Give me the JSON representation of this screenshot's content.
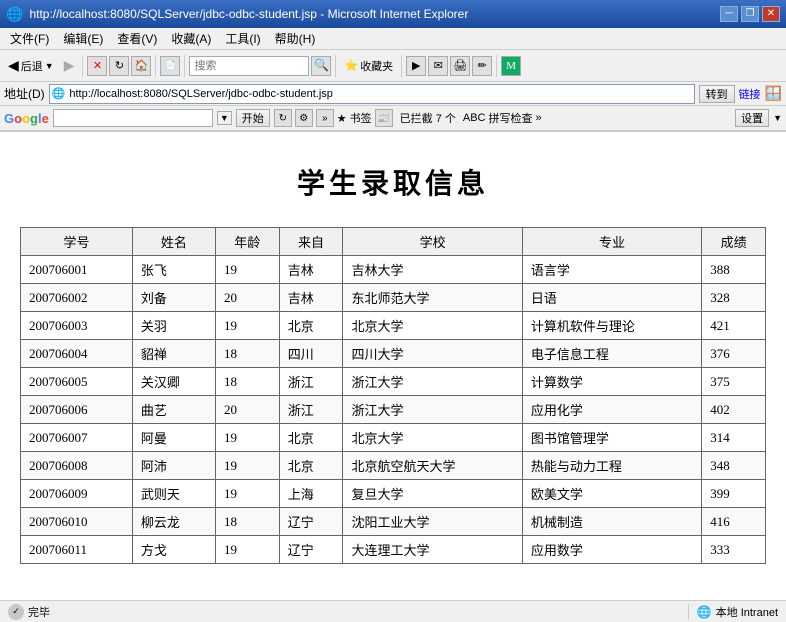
{
  "window": {
    "title": "http://localhost:8080/SQLServer/jdbc-odbc-student.jsp - Microsoft Internet Explorer",
    "icon": "🌐"
  },
  "menubar": {
    "items": [
      "文件(F)",
      "编辑(E)",
      "查看(V)",
      "收藏(A)",
      "工具(I)",
      "帮助(H)"
    ]
  },
  "toolbar": {
    "back": "后退",
    "search": "搜索",
    "favorites": "收藏夹"
  },
  "addressbar": {
    "label": "地址(D)",
    "url": "http://localhost:8080/SQLServer/jdbc-odbc-student.jsp",
    "go": "转到",
    "links": "链接"
  },
  "googlebar": {
    "start": "开始",
    "bookmarks": "书签",
    "loaded": "已拦截 7 个",
    "spellcheck": "拼写检查",
    "settings": "设置"
  },
  "page": {
    "title": "学生录取信息",
    "table": {
      "headers": [
        "学号",
        "姓名",
        "年龄",
        "来自",
        "学校",
        "专业",
        "成绩"
      ],
      "rows": [
        [
          "200706001",
          "张飞",
          "19",
          "吉林",
          "吉林大学",
          "语言学",
          "388"
        ],
        [
          "200706002",
          "刘备",
          "20",
          "吉林",
          "东北师范大学",
          "日语",
          "328"
        ],
        [
          "200706003",
          "关羽",
          "19",
          "北京",
          "北京大学",
          "计算机软件与理论",
          "421"
        ],
        [
          "200706004",
          "貂禅",
          "18",
          "四川",
          "四川大学",
          "电子信息工程",
          "376"
        ],
        [
          "200706005",
          "关汉卿",
          "18",
          "浙江",
          "浙江大学",
          "计算数学",
          "375"
        ],
        [
          "200706006",
          "曲艺",
          "20",
          "浙江",
          "浙江大学",
          "应用化学",
          "402"
        ],
        [
          "200706007",
          "阿曼",
          "19",
          "北京",
          "北京大学",
          "图书馆管理学",
          "314"
        ],
        [
          "200706008",
          "阿沛",
          "19",
          "北京",
          "北京航空航天大学",
          "热能与动力工程",
          "348"
        ],
        [
          "200706009",
          "武则天",
          "19",
          "上海",
          "复旦大学",
          "欧美文学",
          "399"
        ],
        [
          "200706010",
          "柳云龙",
          "18",
          "辽宁",
          "沈阳工业大学",
          "机械制造",
          "416"
        ],
        [
          "200706011",
          "方戈",
          "19",
          "辽宁",
          "大连理工大学",
          "应用数学",
          "333"
        ]
      ]
    }
  },
  "statusbar": {
    "left": "完毕",
    "right": "本地 Intranet"
  }
}
